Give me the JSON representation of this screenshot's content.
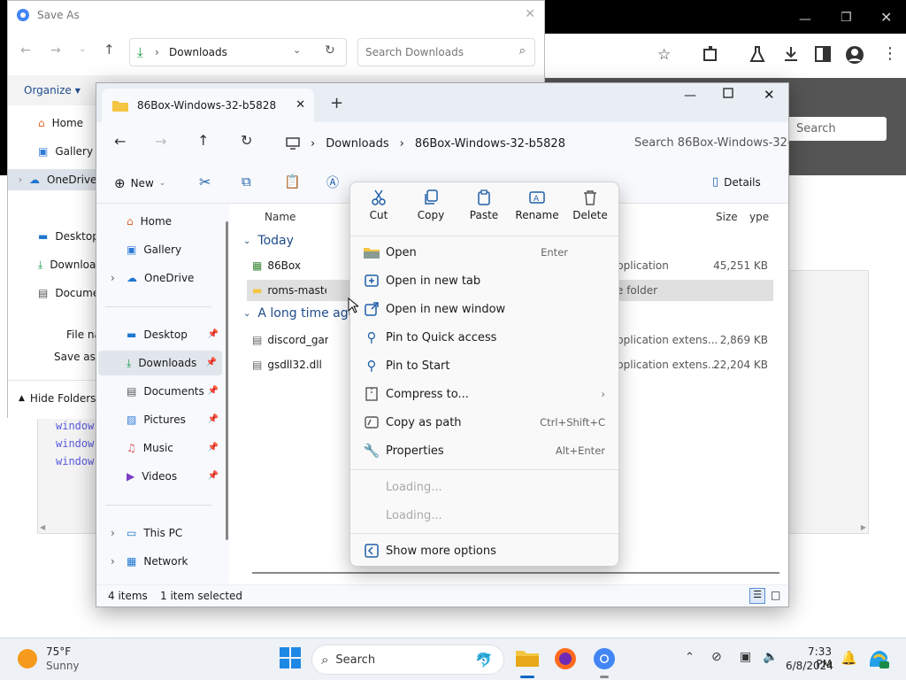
{
  "chrome": {
    "search_placeholder": "Search",
    "code_lines": [
      "window",
      "window",
      "window"
    ]
  },
  "saveas": {
    "title": "Save As",
    "address": "Downloads",
    "search_placeholder": "Search Downloads",
    "organize": "Organize",
    "nav": [
      "Home",
      "Gallery",
      "OneDrive",
      "Desktop",
      "Downloa",
      "Docume"
    ],
    "filename_label": "File na",
    "savetype_label": "Save as ty",
    "hide_folders": "Hide Folders"
  },
  "explorer": {
    "tab_title": "86Box-Windows-32-b5828",
    "breadcrumb": [
      "Downloads",
      "86Box-Windows-32-b5828"
    ],
    "search_placeholder": "Search 86Box-Windows-32-b",
    "new_label": "New",
    "details_label": "Details",
    "columns": {
      "name": "Name",
      "type": "ype",
      "size": "Size"
    },
    "sidebar": {
      "home": "Home",
      "gallery": "Gallery",
      "onedrive": "OneDrive",
      "desktop": "Desktop",
      "downloads": "Downloads",
      "documents": "Documents",
      "pictures": "Pictures",
      "music": "Music",
      "videos": "Videos",
      "thispc": "This PC",
      "network": "Network"
    },
    "groups": {
      "today": "Today",
      "long_ago": "A long time ago"
    },
    "files": [
      {
        "name": "86Box",
        "type": "pplication",
        "size": "45,251 KB"
      },
      {
        "name": "roms-master",
        "type": "e folder",
        "size": ""
      },
      {
        "name": "discord_game_sd",
        "type": "pplication extens...",
        "size": "2,869 KB"
      },
      {
        "name": "gsdll32.dll",
        "type": "pplication extens...",
        "size": "22,204 KB"
      }
    ],
    "status": {
      "items": "4 items",
      "selected": "1 item selected"
    }
  },
  "context_menu": {
    "quick_actions": [
      "Cut",
      "Copy",
      "Paste",
      "Rename",
      "Delete"
    ],
    "items": [
      {
        "label": "Open",
        "shortcut": "Enter"
      },
      {
        "label": "Open in new tab",
        "shortcut": ""
      },
      {
        "label": "Open in new window",
        "shortcut": ""
      },
      {
        "label": "Pin to Quick access",
        "shortcut": ""
      },
      {
        "label": "Pin to Start",
        "shortcut": ""
      },
      {
        "label": "Compress to...",
        "shortcut": ""
      },
      {
        "label": "Copy as path",
        "shortcut": "Ctrl+Shift+C"
      },
      {
        "label": "Properties",
        "shortcut": "Alt+Enter"
      }
    ],
    "loading": [
      "Loading...",
      "Loading..."
    ],
    "more": "Show more options"
  },
  "taskbar": {
    "weather_temp": "75°F",
    "weather_desc": "Sunny",
    "search_label": "Search",
    "time": "7:33 PM",
    "date": "6/8/2024"
  },
  "colors": {
    "accent": "#0067c0",
    "folder": "#f4c542",
    "selected_nav": "#e1e6ed"
  }
}
